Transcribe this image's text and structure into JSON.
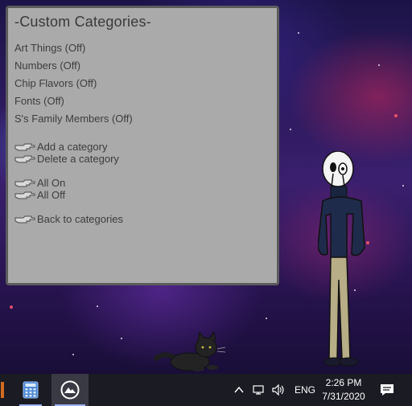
{
  "menu": {
    "title": "-Custom Categories-",
    "categories": [
      "Art Things (Off)",
      "Numbers (Off)",
      "Chip Flavors (Off)",
      "Fonts (Off)",
      "S's Family Members (Off)"
    ],
    "actions": {
      "add": "Add a category",
      "delete": "Delete a category",
      "all_on": "All On",
      "all_off": "All Off",
      "back": "Back to categories"
    }
  },
  "taskbar": {
    "apps": [
      "calculator-icon",
      "mountain-app-icon"
    ],
    "tray": {
      "language": "ENG",
      "time": "2:26 PM",
      "date": "7/31/2020"
    }
  },
  "colors": {
    "panel_bg": "#aaaaaa",
    "panel_border": "#5b5b5b",
    "taskbar_bg": "#1b1b24"
  }
}
